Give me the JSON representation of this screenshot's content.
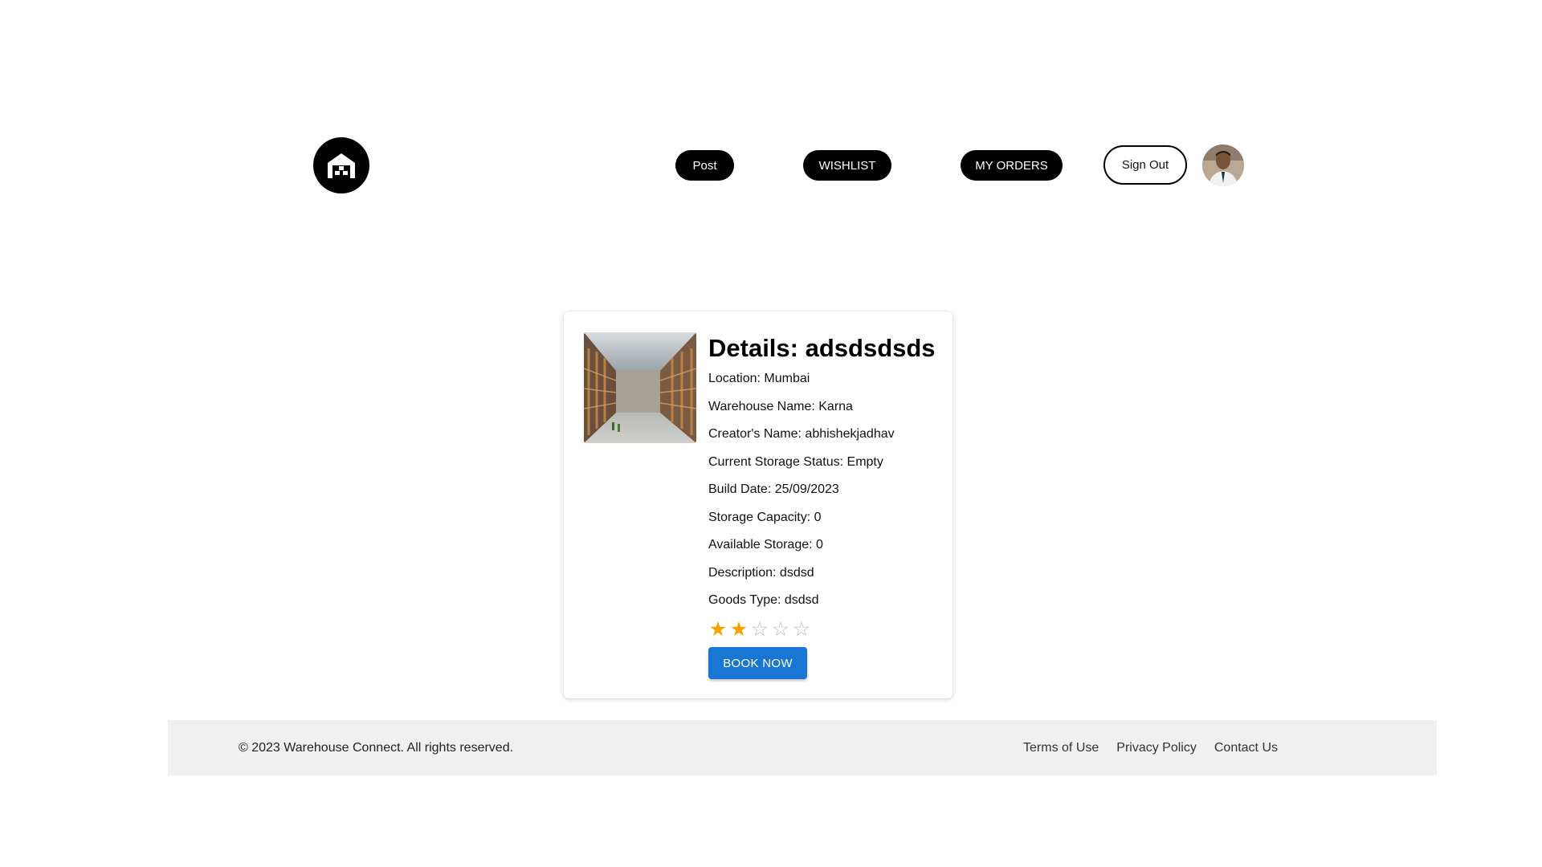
{
  "header": {
    "logo_icon": "warehouse-icon",
    "nav": {
      "post_label": "Post",
      "wishlist_label": "WISHLIST",
      "orders_label": "MY ORDERS",
      "signout_label": "Sign Out"
    },
    "avatar_icon": "user-avatar"
  },
  "card": {
    "title": "Details: adsdsdsds",
    "image_icon": "warehouse-photo",
    "details": {
      "location": "Location: Mumbai",
      "warehouse_name": "Warehouse Name: Karna",
      "creator_name": "Creator's Name: abhishekjadhav",
      "storage_status": "Current Storage Status: Empty",
      "build_date": "Build Date: 25/09/2023",
      "storage_capacity": "Storage Capacity: 0",
      "available_storage": "Available Storage: 0",
      "description": "Description: dsdsd",
      "goods_type": "Goods Type: dsdsd"
    },
    "rating": {
      "value": 2,
      "max": 5,
      "filled_color": "#f5a300",
      "empty_color": "#bdbdbd"
    },
    "book_label": "BOOK NOW",
    "book_color": "#1976d2"
  },
  "footer": {
    "copyright": "© 2023 Warehouse Connect. All rights reserved.",
    "links": [
      "Terms of Use",
      "Privacy Policy",
      "Contact Us"
    ]
  }
}
